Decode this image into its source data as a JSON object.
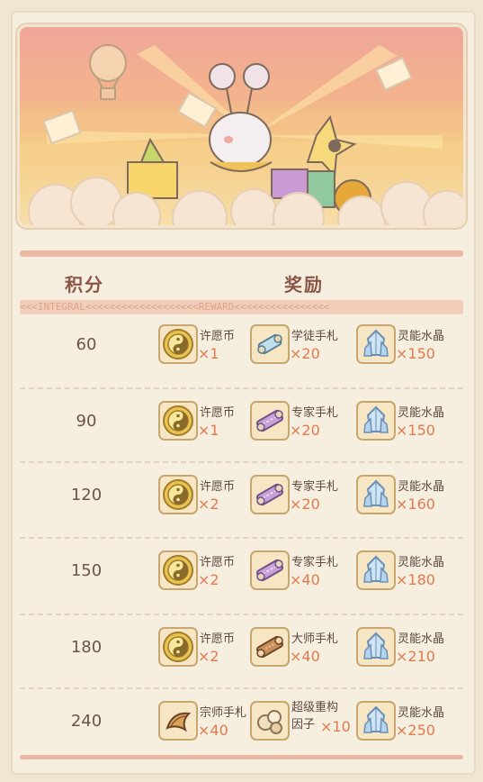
{
  "headers": {
    "score_title": "积分",
    "reward_title": "奖励"
  },
  "strip_text": "<<<INTEGRAL<<<<<<<<<<<<<<<<<<<REWARD<<<<<<<<<<<<<<<<",
  "colors": {
    "accent": "#e27a4f",
    "divider": "#eab7a3"
  },
  "rows": [
    {
      "score": "60",
      "rewards": [
        {
          "name": "许愿币",
          "qty": "×1",
          "icon": "yin-yang-coin-icon"
        },
        {
          "name": "学徒手札",
          "qty": "×20",
          "icon": "apprentice-scroll-icon"
        },
        {
          "name": "灵能水晶",
          "qty": "×150",
          "icon": "crystal-icon"
        }
      ]
    },
    {
      "score": "90",
      "rewards": [
        {
          "name": "许愿币",
          "qty": "×1",
          "icon": "yin-yang-coin-icon"
        },
        {
          "name": "专家手札",
          "qty": "×20",
          "icon": "expert-scroll-icon"
        },
        {
          "name": "灵能水晶",
          "qty": "×150",
          "icon": "crystal-icon"
        }
      ]
    },
    {
      "score": "120",
      "rewards": [
        {
          "name": "许愿币",
          "qty": "×2",
          "icon": "yin-yang-coin-icon"
        },
        {
          "name": "专家手札",
          "qty": "×20",
          "icon": "expert-scroll-icon"
        },
        {
          "name": "灵能水晶",
          "qty": "×160",
          "icon": "crystal-icon"
        }
      ]
    },
    {
      "score": "150",
      "rewards": [
        {
          "name": "许愿币",
          "qty": "×2",
          "icon": "yin-yang-coin-icon"
        },
        {
          "name": "专家手札",
          "qty": "×40",
          "icon": "expert-scroll-icon"
        },
        {
          "name": "灵能水晶",
          "qty": "×180",
          "icon": "crystal-icon"
        }
      ]
    },
    {
      "score": "180",
      "rewards": [
        {
          "name": "许愿币",
          "qty": "×2",
          "icon": "yin-yang-coin-icon"
        },
        {
          "name": "大师手札",
          "qty": "×40",
          "icon": "master-scroll-icon"
        },
        {
          "name": "灵能水晶",
          "qty": "×210",
          "icon": "crystal-icon"
        }
      ]
    },
    {
      "score": "240",
      "rewards": [
        {
          "name": "宗师手札",
          "qty": "×40",
          "icon": "grandmaster-scroll-icon"
        },
        {
          "name": "超级重构",
          "name2": "因子",
          "qty": "×10",
          "icon": "reconstruct-factor-icon"
        },
        {
          "name": "灵能水晶",
          "qty": "×250",
          "icon": "crystal-icon"
        }
      ]
    }
  ]
}
